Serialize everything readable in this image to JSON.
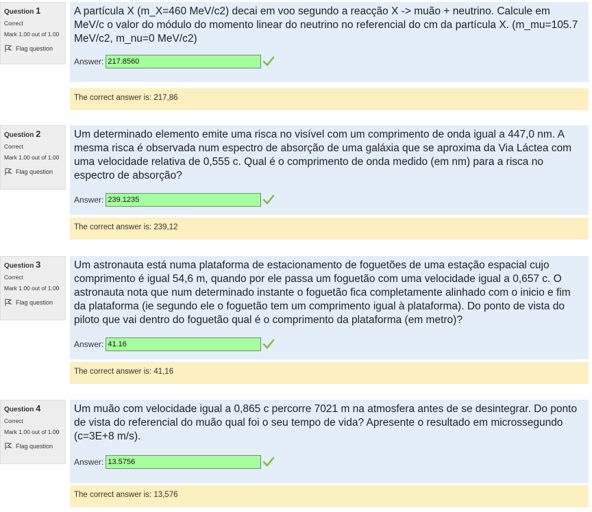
{
  "common": {
    "state": "Correct",
    "mark": "Mark 1.00 out of 1.00",
    "flag_label": "Flag question",
    "answer_label": "Answer:",
    "question_word": "Question"
  },
  "questions": [
    {
      "number": "1",
      "text": "A partícula X (m_X=460 MeV/c2) decai em voo segundo a reacção X -> muão + neutrino. Calcule em MeV/c o valor do módulo do momento linear do neutrino no referencial do cm da partícula X. (m_mu=105.7 MeV/c2, m_nu=0 MeV/c2)",
      "answer": "217.8560",
      "correct_answer": "The correct answer is: 217,86"
    },
    {
      "number": "2",
      "text": "Um determinado elemento emite uma risca no visível com um comprimento de onda igual a 447,0 nm. A mesma risca é observada num espectro de absorção de uma galáxia que se aproxima da Via Láctea com uma velocidade relativa de 0,555 c. Qual é o comprimento de onda medido (em nm) para a risca no espectro de absorção?",
      "answer": "239.1235",
      "correct_answer": "The correct answer is: 239,12"
    },
    {
      "number": "3",
      "text": "Um astronauta está numa plataforma de estacionamento de foguetões de uma estação espacial cujo comprimento é igual 54,6 m, quando por ele passa um foguetão com uma velocidade igual a 0,657 c. O astronauta nota que num determinado instante o foguetão fica completamente alinhado com o inicio e fim da plataforma (ie segundo ele o foguetão tem um comprimento igual à plataforma). Do ponto de vista do piloto que vai dentro do foguetão qual é o comprimento da plataforma (em metro)?",
      "answer": "41.16",
      "correct_answer": "The correct answer is: 41,16"
    },
    {
      "number": "4",
      "text": "Um muão com velocidade igual a 0,865 c percorre 7021 m na atmosfera antes de se desintegrar. Do ponto de vista do referencial do muão qual foi o seu tempo de vida? Apresente o resultado em microssegundo (c=3E+8 m/s).",
      "answer": "13.5756",
      "correct_answer": "The correct answer is: 13,576"
    }
  ],
  "colors": {
    "info_bg": "#eeeeee",
    "formulation_bg": "#e4eef8",
    "answer_correct_bg": "#a6ff9e",
    "feedback_bg": "#fcefc0",
    "check": "#7bbf3a"
  }
}
